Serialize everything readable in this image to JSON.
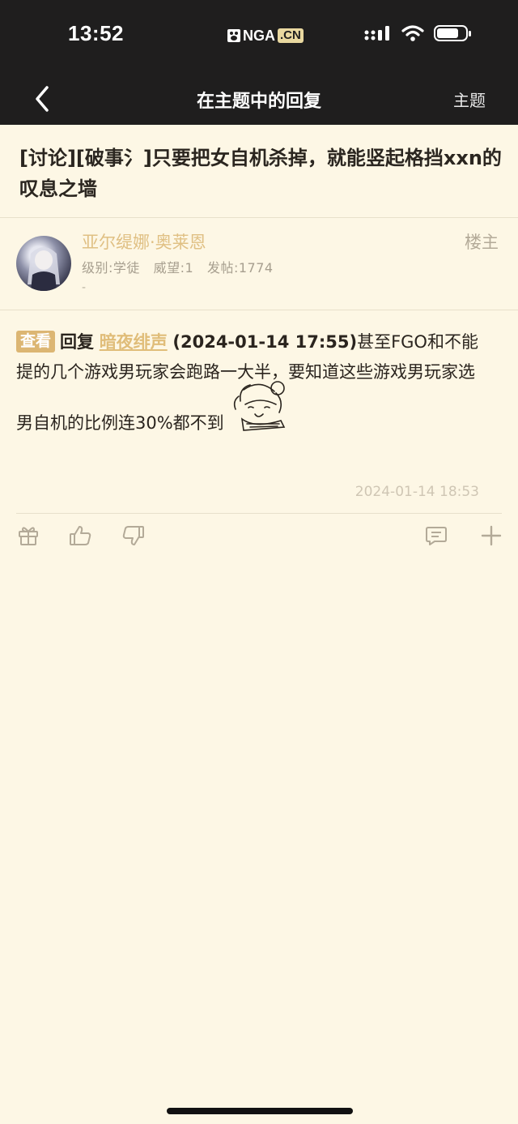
{
  "status_bar": {
    "time": "13:52",
    "logo_text": "NGA",
    "logo_suffix": ".CN",
    "icons": [
      "signal-icon",
      "wifi-icon",
      "battery-icon"
    ]
  },
  "nav": {
    "back_icon": "chevron-left-icon",
    "title": "在主题中的回复",
    "right_label": "主题"
  },
  "topic": {
    "title": "[讨论][破事氵]只要把女自机杀掉，就能竖起格挡xxn的叹息之墙"
  },
  "post": {
    "username": "亚尔缇娜·奥莱恩",
    "floor_tag": "楼主",
    "user_meta": "级别:学徒   威望:1   发帖:1774",
    "signature": "-",
    "check_label": "查看",
    "reply_word": "回复",
    "reply_user": "暗夜绯声",
    "reply_time": "(2024-01-14 17:55)",
    "content_line1": "甚至FGO和不能提的几个游戏男玩家会跑路一大半，要知道这些游戏男玩家选",
    "content_line2": "男自机的比例连30%都不到",
    "emoji_icon": "anime-girl-sticker-icon",
    "timestamp": "2024-01-14 18:53"
  },
  "actions": [
    "gift-icon",
    "thumb-up-icon",
    "thumb-down-icon",
    "comment-icon",
    "plus-icon"
  ],
  "colors": {
    "header_bg": "#1f1e1e",
    "page_bg": "#fdf7e5",
    "accent": "#dcb673",
    "username": "#e0c084"
  }
}
